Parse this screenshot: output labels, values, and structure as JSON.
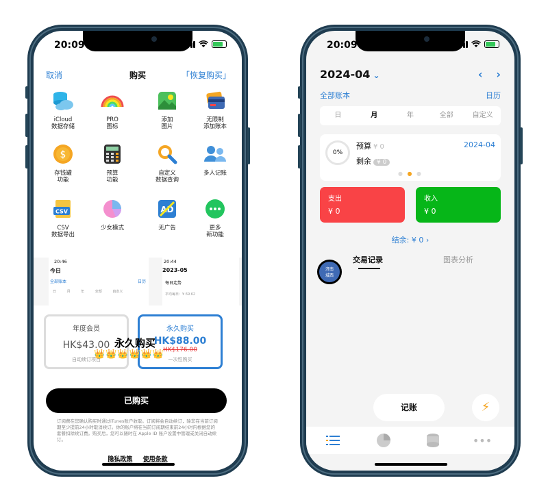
{
  "left_phone": {
    "status_time": "20:09",
    "nav": {
      "cancel": "取消",
      "title": "购买",
      "restore": "「恢复购买」"
    },
    "features": [
      {
        "icon": "cloud-database-icon",
        "label": "iCloud\n数据存储"
      },
      {
        "icon": "rainbow-icon",
        "label": "PRO\n图标"
      },
      {
        "icon": "picture-icon",
        "label": "添加\n图片"
      },
      {
        "icon": "cards-icon",
        "label": "无限制\n添加账本"
      },
      {
        "icon": "coin-icon",
        "label": "存钱罐\n功能"
      },
      {
        "icon": "calculator-icon",
        "label": "预算\n功能"
      },
      {
        "icon": "magnifier-icon",
        "label": "自定义\n数据查询"
      },
      {
        "icon": "people-icon",
        "label": "多人记账"
      },
      {
        "icon": "csv-icon",
        "label": "CSV\n数据导出"
      },
      {
        "icon": "pie-chart-icon",
        "label": "少女模式"
      },
      {
        "icon": "no-ad-icon",
        "label": "无广告"
      },
      {
        "icon": "more-icon",
        "label": "更多\n新功能"
      }
    ],
    "preview": {
      "time_a": "20:46",
      "title_a": "今日",
      "account_a": "全部账本",
      "calendar_a": "日历",
      "segments_a": [
        "日",
        "月",
        "年",
        "全部",
        "自定义"
      ],
      "time_b": "20:44",
      "title_b": "2023-05",
      "trend_b": "每日走势",
      "avg_b": "平均每日：¥ 69.62"
    },
    "plans": {
      "year": {
        "title": "年度会员",
        "price": "HK$43.00",
        "sub": "自动续订项目"
      },
      "lifetime": {
        "title": "永久购买",
        "price": "HK$88.00",
        "old_price": "HK$176.00",
        "sub": "一次性购买"
      }
    },
    "overlay_title": "永久购买",
    "crowns": "👑👑👑👑👑👑",
    "purchased_button": "已购买",
    "terms_text": "订阅费在您确认购买时通过iTunes账户收取。订阅将会自动续订，除非在当前订阅期至少提前24小时取消续订。你的账户将在当前订阅期结束前24小时内根据您的套餐扣除续订费。购买后，您可以随时在 Apple ID 账户设置中管理或关闭自动续订。",
    "links": {
      "privacy": "隐私政策",
      "terms": "使用条款"
    }
  },
  "right_phone": {
    "status_time": "20:09",
    "month": "2024-04",
    "all_accounts": "全部账本",
    "calendar": "日历",
    "segments": [
      "日",
      "月",
      "年",
      "全部",
      "自定义"
    ],
    "active_segment": "月",
    "budget": {
      "percent": "0%",
      "label": "预算",
      "amount": "¥ 0",
      "remaining_label": "剩余",
      "remaining": "¥ 0",
      "date": "2024-04"
    },
    "expense": {
      "label": "支出",
      "value": "¥ 0"
    },
    "income": {
      "label": "收入",
      "value": "¥ 0"
    },
    "balance": "结余: ¥ 0",
    "tabs": {
      "records": "交易记录",
      "charts": "图表分析"
    },
    "badge": "济南\n城西",
    "record_button": "记账"
  },
  "colors": {
    "accent": "#2d7fd3",
    "expense": "#f94346",
    "income": "#06b618",
    "frame": "#1f3c50"
  }
}
